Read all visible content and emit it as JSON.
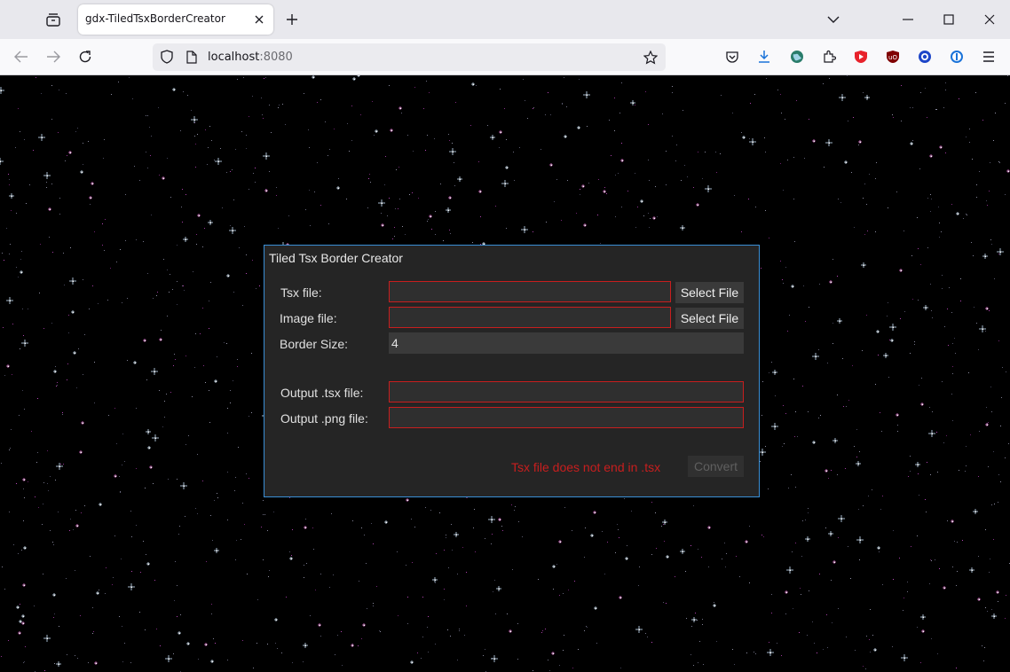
{
  "browser": {
    "tab_title": "gdx-TiledTsxBorderCreator",
    "url_host": "localhost",
    "url_port": ":8080"
  },
  "dialog": {
    "title": "Tiled Tsx Border Creator",
    "tsx_label": "Tsx file:",
    "tsx_value": "",
    "tsx_select": "Select File",
    "image_label": "Image file:",
    "image_value": "",
    "image_select": "Select File",
    "border_label": "Border Size:",
    "border_value": "4",
    "out_tsx_label": "Output .tsx file:",
    "out_tsx_value": "",
    "out_png_label": "Output .png file:",
    "out_png_value": "",
    "error": "Tsx file does not end in .tsx",
    "convert": "Convert"
  },
  "colors": {
    "accent_border": "#3a8fd6",
    "error": "#c81e1e",
    "panel": "#252525"
  }
}
